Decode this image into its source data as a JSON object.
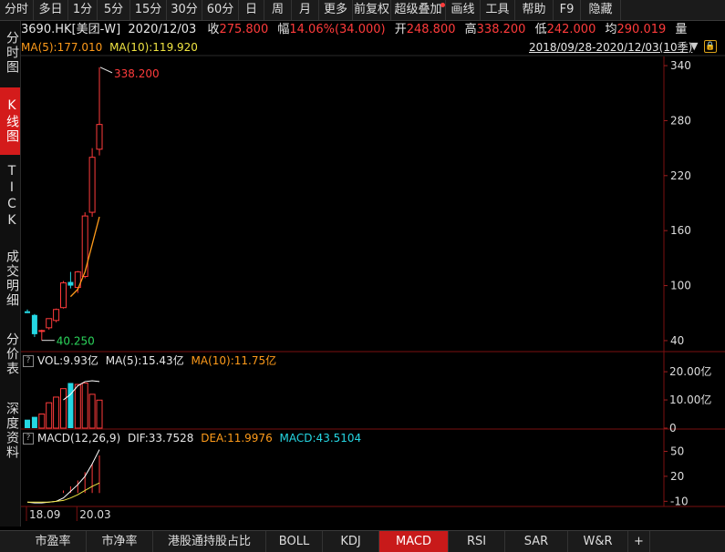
{
  "toolbar": {
    "items": [
      "分时",
      "多日",
      "1分",
      "5分",
      "15分",
      "30分",
      "60分",
      "日",
      "周",
      "月",
      "更多",
      "前复权",
      "超级叠加",
      "画线",
      "工具",
      "帮助",
      "F9",
      "隐藏"
    ]
  },
  "sidebar": {
    "items": [
      "分时图",
      "K线图",
      "TICK",
      "成交明细",
      "分价表",
      "深度资料"
    ],
    "active_index": 1
  },
  "info": {
    "symbol": "3690.HK[美团-W]",
    "date": "2020/12/03",
    "close_label": "收",
    "close": "275.800",
    "range_label": "幅",
    "range": "14.06%(34.000)",
    "open_label": "开",
    "open": "248.800",
    "high_label": "高",
    "high": "338.200",
    "low_label": "低",
    "low": "242.000",
    "avg_label": "均",
    "avg": "290.019",
    "vol_label": "量"
  },
  "ma_bar": {
    "ma5": "MA(5):177.010",
    "ma10": "MA(10):119.920",
    "period": "2018/09/28-2020/12/03(10季)"
  },
  "price_annotations": {
    "high": "338.200",
    "low": "40.250"
  },
  "vol_bar": {
    "vol": "VOL:9.93亿",
    "ma5": "MA(5):15.43亿",
    "ma10": "MA(10):11.75亿"
  },
  "macd_bar": {
    "name": "MACD(12,26,9)",
    "dif": "DIF:33.7528",
    "dea": "DEA:11.9976",
    "macd": "MACD:43.5104"
  },
  "x_labels": [
    "18.09",
    "20.03"
  ],
  "tabs": {
    "items": [
      "市盈率",
      "市净率",
      "港股通持股占比",
      "BOLL",
      "KDJ",
      "MACD",
      "RSI",
      "SAR",
      "W&R",
      "+"
    ],
    "active_index": 5
  },
  "colors": {
    "up": "#ff3b3b",
    "down": "#25d7e3",
    "ma5": "#ffffff",
    "ma10": "#ff9b1a",
    "accent": "#c81a1a"
  },
  "chart_data": {
    "type": "candlestick",
    "period": "quarterly",
    "candles": [
      {
        "o": 72,
        "h": 74,
        "l": 70,
        "c": 70
      },
      {
        "o": 68,
        "h": 69,
        "l": 44,
        "c": 47
      },
      {
        "o": 50,
        "h": 52,
        "l": 40.25,
        "c": 51
      },
      {
        "o": 54,
        "h": 64,
        "l": 52,
        "c": 64
      },
      {
        "o": 62,
        "h": 75,
        "l": 60,
        "c": 74
      },
      {
        "o": 76,
        "h": 105,
        "l": 75,
        "c": 103
      },
      {
        "o": 104,
        "h": 115,
        "l": 97,
        "c": 100
      },
      {
        "o": 98,
        "h": 116,
        "l": 92,
        "c": 115
      },
      {
        "o": 110,
        "h": 180,
        "l": 108,
        "c": 176
      },
      {
        "o": 180,
        "h": 250,
        "l": 175,
        "c": 240
      },
      {
        "o": 248.8,
        "h": 338.2,
        "l": 242,
        "c": 275.8
      }
    ],
    "price_axis": {
      "ticks": [
        40,
        100,
        160,
        220,
        280,
        340
      ],
      "range": [
        30,
        350
      ]
    },
    "ma10_line": [
      {
        "i": 6,
        "v": 88
      },
      {
        "i": 7,
        "v": 96
      },
      {
        "i": 8,
        "v": 115
      },
      {
        "i": 9,
        "v": 145
      },
      {
        "i": 10,
        "v": 175
      }
    ],
    "volume": {
      "unit": "亿",
      "values": [
        3,
        4,
        5,
        9,
        11,
        14,
        16,
        15.5,
        16,
        12,
        9.93
      ],
      "down_flags": [
        true,
        true,
        false,
        false,
        false,
        false,
        true,
        false,
        false,
        false,
        false
      ],
      "ticks": [
        "20.00亿",
        "10.00亿",
        "0"
      ],
      "range": [
        0,
        21
      ],
      "ma_line": [
        {
          "i": 5,
          "v": 10
        },
        {
          "i": 6,
          "v": 12
        },
        {
          "i": 7,
          "v": 15
        },
        {
          "i": 8,
          "v": 16.5
        },
        {
          "i": 9,
          "v": 16.8
        },
        {
          "i": 10,
          "v": 16.5
        }
      ]
    },
    "macd": {
      "ticks": [
        50,
        20,
        -10
      ],
      "range": [
        -14,
        56
      ],
      "bars": [
        0,
        0,
        0,
        0,
        0,
        3,
        8,
        15,
        25,
        35,
        45
      ],
      "dif": [
        -11,
        -12,
        -12,
        -11,
        -10,
        -6,
        2,
        10,
        20,
        35,
        52
      ],
      "dea": [
        -11,
        -11,
        -11,
        -11,
        -10,
        -9,
        -6,
        -2,
        3,
        8,
        12
      ]
    }
  }
}
